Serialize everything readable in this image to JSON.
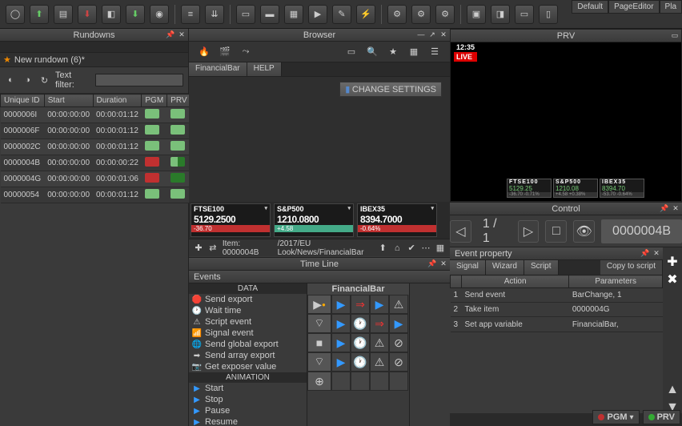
{
  "top_tabs": [
    "Default",
    "PageEditor",
    "Pla"
  ],
  "panels": {
    "rundowns": "Rundowns",
    "browser": "Browser",
    "prv": "PRV",
    "control": "Control",
    "timeline": "Time Line",
    "events": "Events",
    "evprop": "Event property"
  },
  "rundown": {
    "title": "New rundown (6)*",
    "filter_label": "Text filter:",
    "filter_value": "",
    "cols": [
      "Unique ID",
      "Start",
      "Duration",
      "PGM",
      "PRV"
    ],
    "rows": [
      {
        "id": "0000006I",
        "start": "00:00:00:00",
        "dur": "00:00:01:12",
        "pgm": "g",
        "prv": "g"
      },
      {
        "id": "0000006F",
        "start": "00:00:00:00",
        "dur": "00:00:01:12",
        "pgm": "g",
        "prv": "g"
      },
      {
        "id": "0000002C",
        "start": "00:00:00:00",
        "dur": "00:00:01:12",
        "pgm": "g",
        "prv": "g"
      },
      {
        "id": "0000004B",
        "start": "00:00:00:00",
        "dur": "00:00:00:22",
        "pgm": "r",
        "prv": "gr"
      },
      {
        "id": "0000004G",
        "start": "00:00:00:00",
        "dur": "00:00:01:06",
        "pgm": "r",
        "prv": "dg"
      },
      {
        "id": "00000054",
        "start": "00:00:00:00",
        "dur": "00:00:01:12",
        "pgm": "g",
        "prv": "g"
      }
    ]
  },
  "browser": {
    "tabs": [
      "FinancialBar",
      "HELP"
    ],
    "change_btn": "CHANGE SETTINGS",
    "tickers": [
      {
        "name": "FTSE100",
        "value": "5129.2500",
        "chg": "-36.70",
        "color": "#c03030"
      },
      {
        "name": "S&P500",
        "value": "1210.0800",
        "chg": "+4.58",
        "color": "#4a8"
      },
      {
        "name": "IBEX35",
        "value": "8394.7000",
        "chg": "-0.64%",
        "color": "#c03030"
      }
    ],
    "footer": {
      "item": "Item: 0000004B",
      "path": "/2017/EU Look/News/FinancialBar"
    }
  },
  "timeline": {
    "fb_title": "FinancialBar",
    "data_cat": "DATA",
    "anim_cat": "ANIMATION",
    "data_items": [
      "Send export",
      "Wait time",
      "Script event",
      "Signal event",
      "Send global export",
      "Send array export",
      "Get exposer value"
    ],
    "anim_items": [
      "Start",
      "Stop",
      "Pause",
      "Resume"
    ]
  },
  "prv": {
    "time": "12:35",
    "live": "LIVE",
    "tickers": [
      {
        "n": "FTSE100",
        "v": "5129.25",
        "c": "-36.70 -0.71%"
      },
      {
        "n": "S&P500",
        "v": "1210.08",
        "c": "+4.58 +0.38%"
      },
      {
        "n": "IBEX35",
        "v": "8394.70",
        "c": "-53.70 -0.64%"
      }
    ]
  },
  "control": {
    "page": "1 / 1",
    "id": "0000004B"
  },
  "evprop": {
    "tabs": [
      "Signal",
      "Wizard",
      "Script"
    ],
    "copy": "Copy to script",
    "cols": [
      "",
      "Action",
      "Parameters"
    ],
    "rows": [
      {
        "n": "1",
        "a": "Send event",
        "p": "BarChange, 1"
      },
      {
        "n": "2",
        "a": "Take item",
        "p": "0000004G"
      },
      {
        "n": "3",
        "a": "Set app variable",
        "p": "FinancialBar, <empty>"
      }
    ]
  },
  "footer_btns": {
    "pgm": "PGM",
    "prv": "PRV"
  }
}
